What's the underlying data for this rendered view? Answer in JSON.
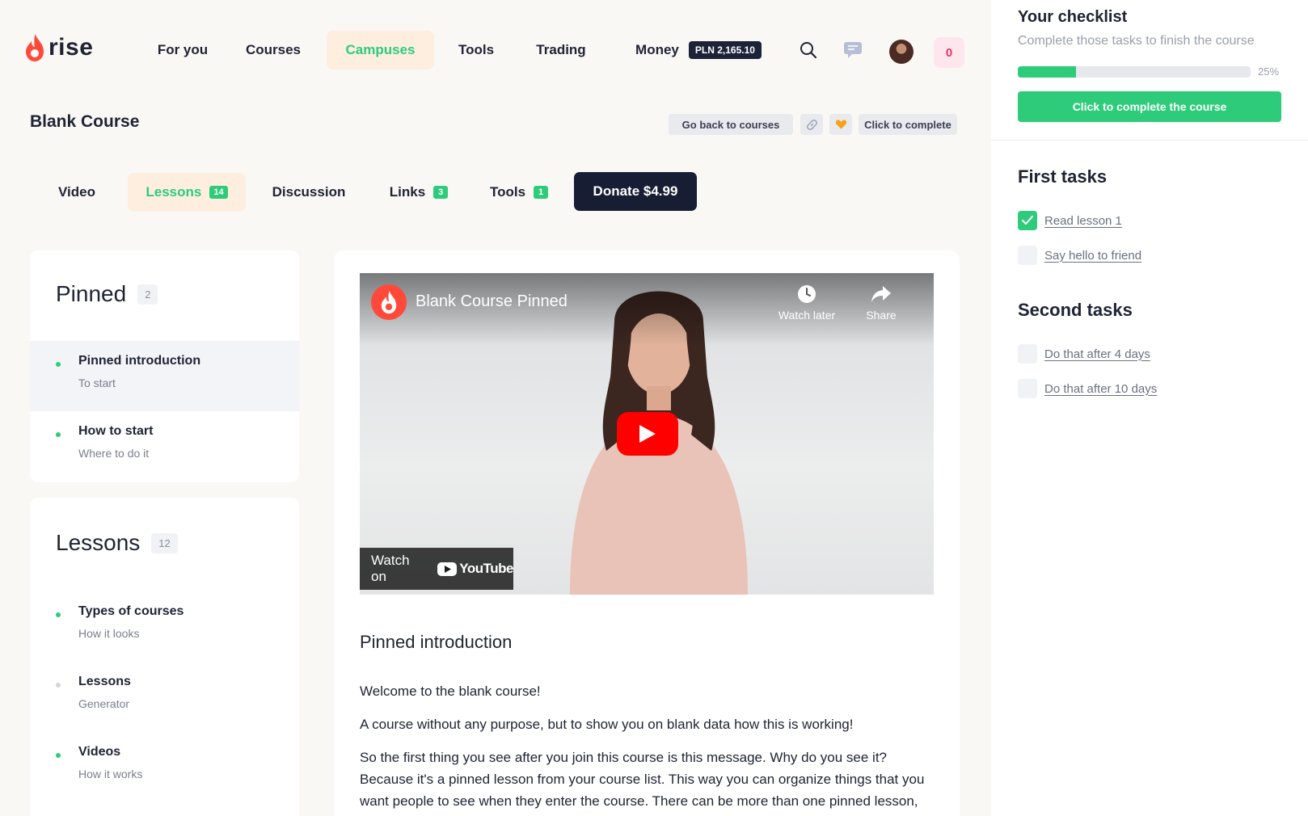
{
  "brand": {
    "name": "rise",
    "flame_color": "#ff4a3b"
  },
  "nav": {
    "items": [
      {
        "label": "For you"
      },
      {
        "label": "Courses"
      },
      {
        "label": "Campuses",
        "active": true
      },
      {
        "label": "Tools"
      },
      {
        "label": "Trading"
      },
      {
        "label": "Money"
      }
    ],
    "money_balance": "PLN 2,165.10",
    "icons": [
      "search-icon",
      "chat-icon",
      "avatar",
      "cart"
    ],
    "cart_count": "0"
  },
  "course": {
    "title": "Blank Course",
    "actions": {
      "back": "Go back to courses",
      "complete": "Click to complete"
    }
  },
  "tabs": [
    {
      "label": "Video"
    },
    {
      "label": "Lessons",
      "count": "14",
      "active": true
    },
    {
      "label": "Discussion"
    },
    {
      "label": "Links",
      "count": "3"
    },
    {
      "label": "Tools",
      "count": "1"
    }
  ],
  "donate_label": "Donate $4.99",
  "pinned": {
    "title": "Pinned",
    "count": "2",
    "items": [
      {
        "title": "Pinned introduction",
        "subtitle": "To start",
        "selected": true
      },
      {
        "title": "How to start",
        "subtitle": "Where to do it"
      }
    ]
  },
  "lessons": {
    "title": "Lessons",
    "count": "12",
    "items": [
      {
        "title": "Types of courses",
        "subtitle": "How it looks"
      },
      {
        "title": "Lessons",
        "subtitle": "Generator",
        "dot": "grey"
      },
      {
        "title": "Videos",
        "subtitle": "How it works"
      }
    ]
  },
  "video": {
    "title": "Blank Course Pinned",
    "watch_later": "Watch later",
    "share": "Share",
    "watch_on": "Watch on",
    "platform": "YouTube"
  },
  "article": {
    "title": "Pinned introduction",
    "paragraphs": [
      "Welcome to the blank course!",
      "A course without any purpose, but to show you on blank data how this is working!",
      "So the first thing you see after you join this course is this message. Why do you see it? Because it's a pinned lesson from your course list. This way you can organize things that you want people to see when they enter the course. There can be more than one pinned lesson, but you can organize them in a way you like."
    ]
  },
  "checklist": {
    "title": "Your checklist",
    "subtitle": "Complete those tasks to finish the course",
    "progress": 0.25,
    "progress_label": "25%",
    "button": "Click to complete the course",
    "sections": [
      {
        "title": "First tasks",
        "tasks": [
          {
            "label": "Read lesson 1",
            "done": true
          },
          {
            "label": "Say hello to friend",
            "done": false
          }
        ]
      },
      {
        "title": "Second tasks",
        "tasks": [
          {
            "label": "Do that after 4 days",
            "done": false
          },
          {
            "label": "Do that after 10 days",
            "done": false
          }
        ]
      }
    ]
  },
  "colors": {
    "accent": "#2ecc7a",
    "dark": "#171d33",
    "active_tab_bg": "#fdeee0",
    "cart": "#e8356b"
  }
}
